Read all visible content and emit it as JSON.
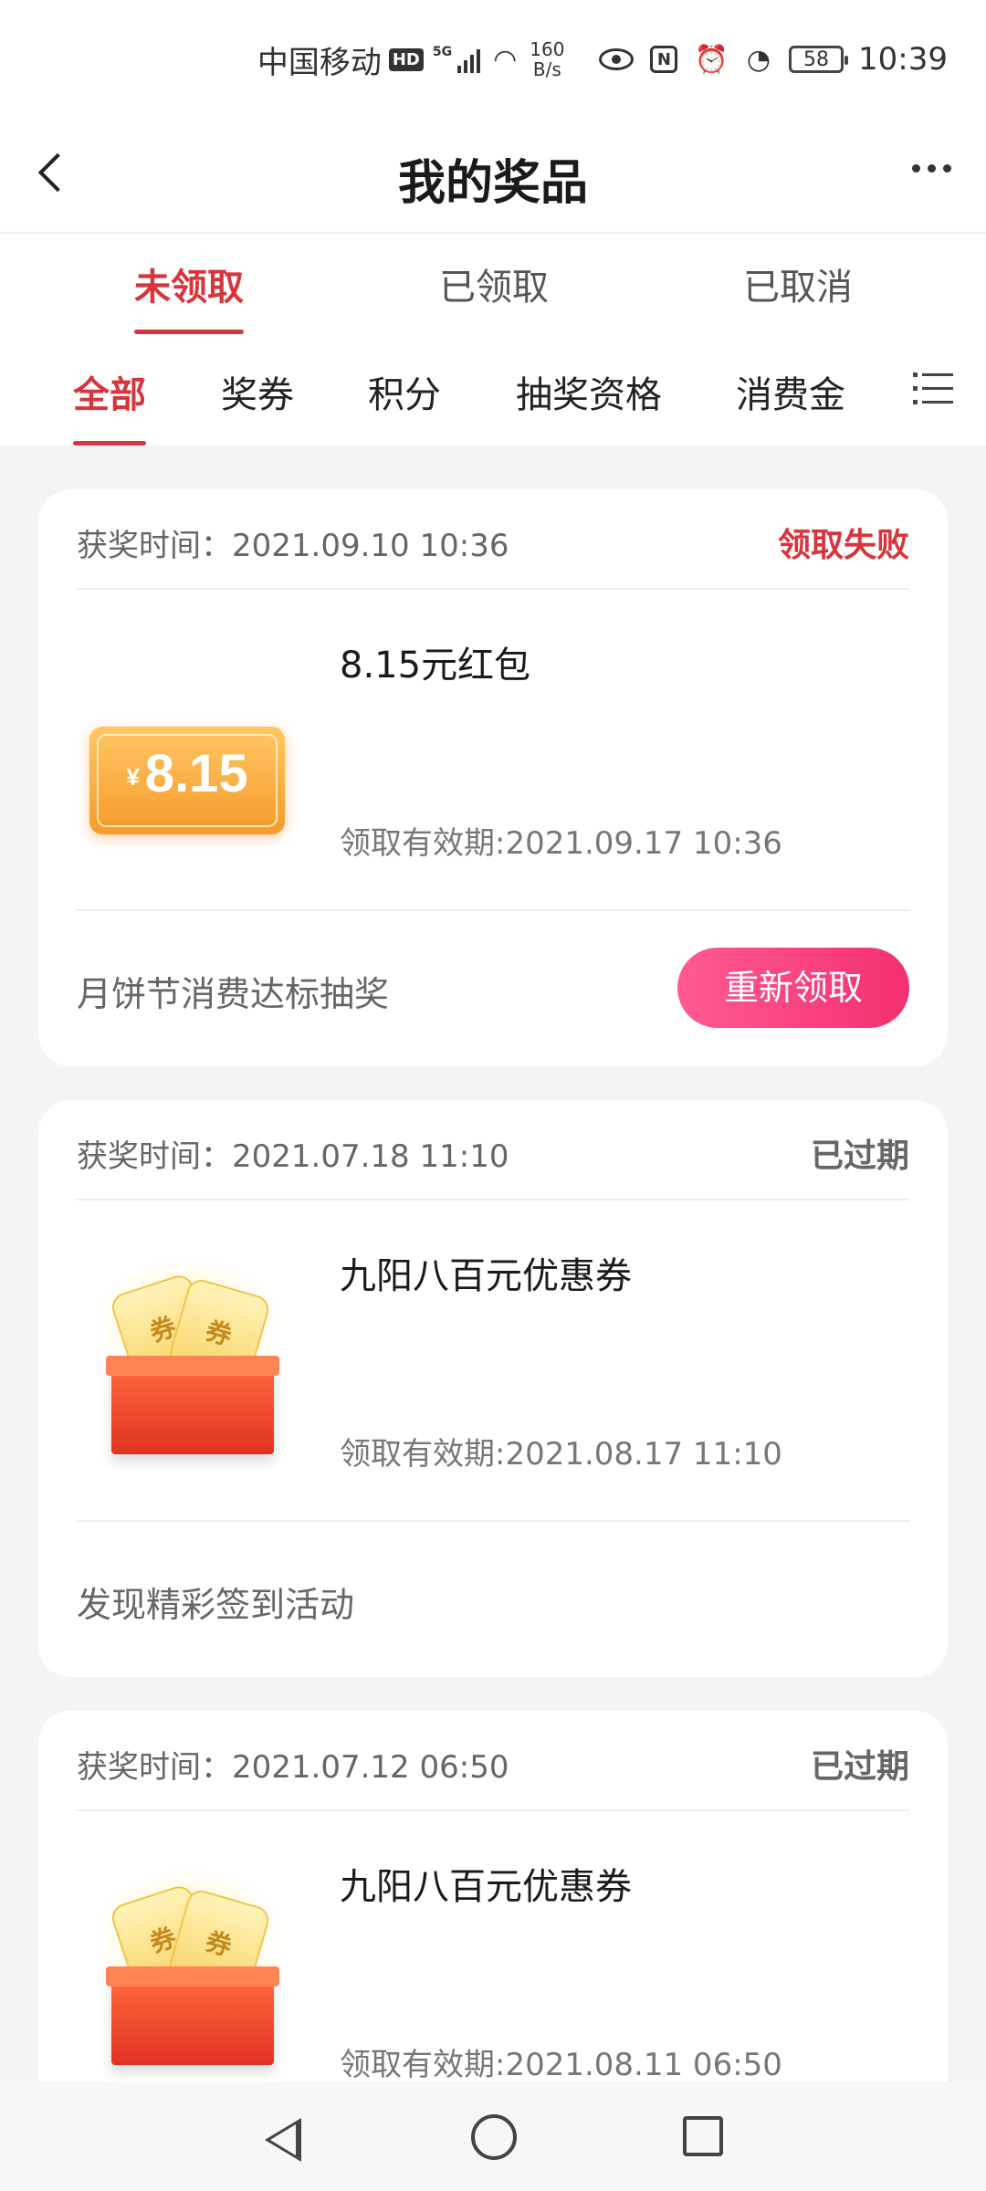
{
  "status_bar": {
    "carrier": "中国移动",
    "hd_badge": "HD",
    "network": "5G",
    "speed_value": "160",
    "speed_unit": "B/s",
    "nfc": "N",
    "battery": "58",
    "time": "10:39"
  },
  "header": {
    "title": "我的奖品"
  },
  "primary_tabs": [
    {
      "label": "未领取",
      "active": true
    },
    {
      "label": "已领取",
      "active": false
    },
    {
      "label": "已取消",
      "active": false
    }
  ],
  "secondary_tabs": [
    {
      "label": "全部",
      "active": true
    },
    {
      "label": "奖券",
      "active": false
    },
    {
      "label": "积分",
      "active": false
    },
    {
      "label": "抽奖资格",
      "active": false
    },
    {
      "label": "消费金",
      "active": false
    }
  ],
  "prizes": [
    {
      "win_time": "获奖时间：2021.09.10 10:36",
      "status": "领取失败",
      "image": "red-packet",
      "image_currency": "¥",
      "image_amount": "8.15",
      "name": "8.15元红包",
      "validity": "领取有效期:2021.09.17 10:36",
      "source": "月饼节消费达标抽奖",
      "action_label": "重新领取"
    },
    {
      "win_time": "获奖时间：2021.07.18 11:10",
      "status": "已过期",
      "image": "coupon-box",
      "ticket_text": "券",
      "name": "九阳八百元优惠券",
      "validity": "领取有效期:2021.08.17 11:10",
      "source": "发现精彩签到活动"
    },
    {
      "win_time": "获奖时间：2021.07.12 06:50",
      "status": "已过期",
      "image": "coupon-box",
      "ticket_text": "券",
      "name": "九阳八百元优惠券",
      "validity": "领取有效期:2021.08.11 06:50"
    }
  ],
  "colors": {
    "accent": "#d8343b",
    "button_gradient_start": "#ff5a91",
    "button_gradient_end": "#f4306f",
    "background": "#f4f4f4"
  }
}
